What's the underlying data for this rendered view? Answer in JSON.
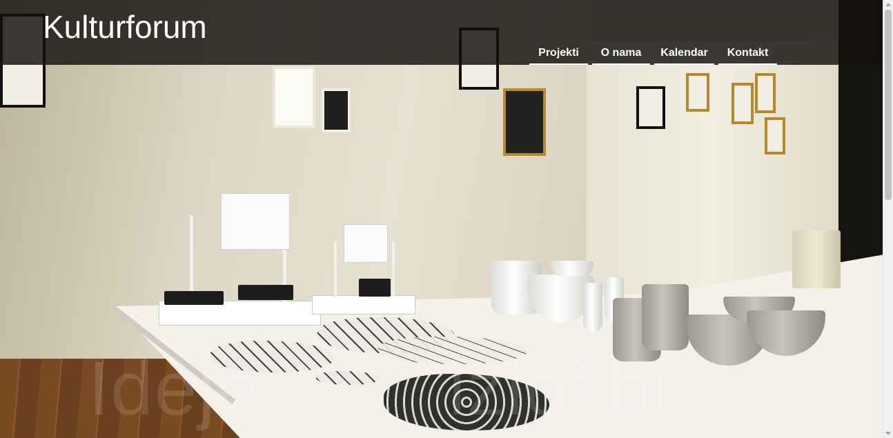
{
  "site": {
    "title": "Kulturforum"
  },
  "nav": {
    "items": [
      {
        "label": "Projekti"
      },
      {
        "label": "O nama"
      },
      {
        "label": "Kalendar"
      },
      {
        "label": "Kontakt"
      }
    ]
  },
  "hero": {
    "watermark_left": "Ideje",
    "watermark_right": "izložbi"
  },
  "colors": {
    "header_bg": "#12100e",
    "nav_text": "#ffffff",
    "underline": "#ffffff"
  },
  "icons": {
    "scroll_up": "caret-up-icon",
    "scroll_down": "caret-down-icon"
  }
}
